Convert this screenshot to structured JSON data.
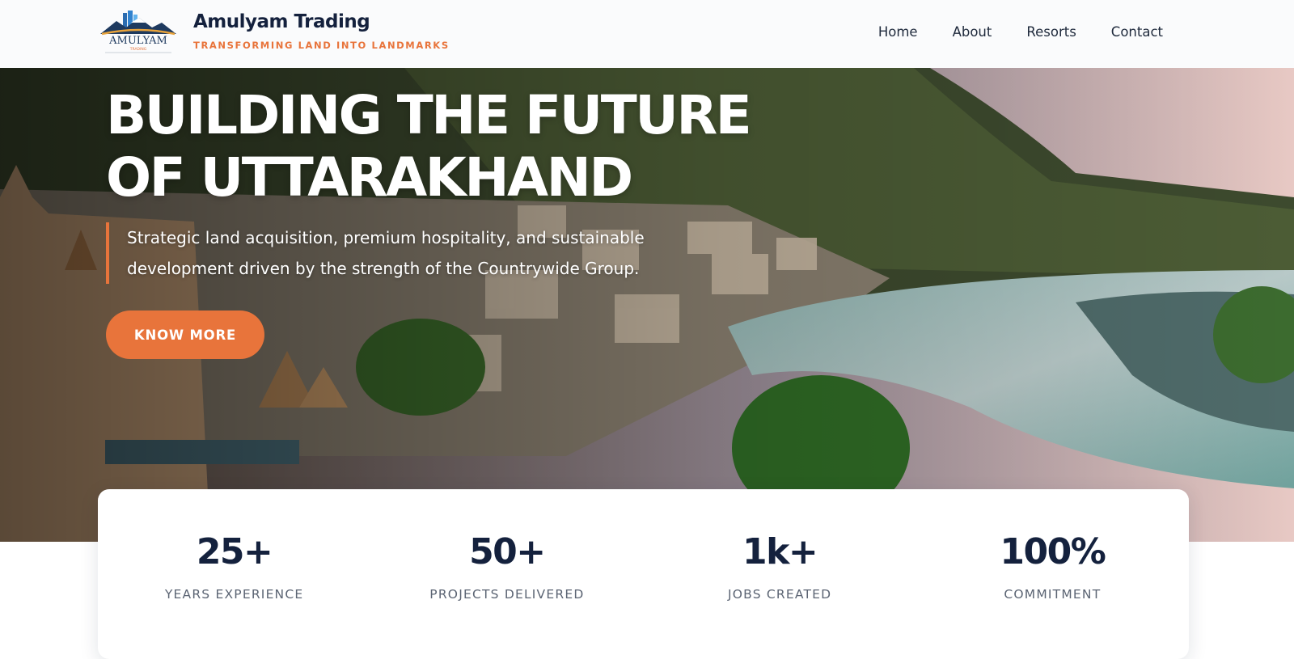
{
  "header": {
    "logo_text": "AMULYAM",
    "logo_subtext": "TRADING",
    "brand_name": "Amulyam Trading",
    "tagline": "TRANSFORMING LAND INTO LANDMARKS",
    "nav": [
      {
        "label": "Home"
      },
      {
        "label": "About"
      },
      {
        "label": "Resorts"
      },
      {
        "label": "Contact"
      }
    ]
  },
  "hero": {
    "title_line1": "BUILDING THE FUTURE",
    "title_line2": "OF UTTARAKHAND",
    "subtitle_line1": "Strategic land acquisition, premium hospitality, and sustainable",
    "subtitle_line2": "development driven by the strength of the Countrywide Group.",
    "cta_label": "KNOW MORE"
  },
  "stats": [
    {
      "value": "25+",
      "label": "YEARS EXPERIENCE"
    },
    {
      "value": "50+",
      "label": "PROJECTS DELIVERED"
    },
    {
      "value": "1k+",
      "label": "JOBS CREATED"
    },
    {
      "value": "100%",
      "label": "COMMITMENT"
    }
  ],
  "colors": {
    "accent": "#e8743b",
    "navy": "#14213d",
    "muted": "#5b6473"
  }
}
